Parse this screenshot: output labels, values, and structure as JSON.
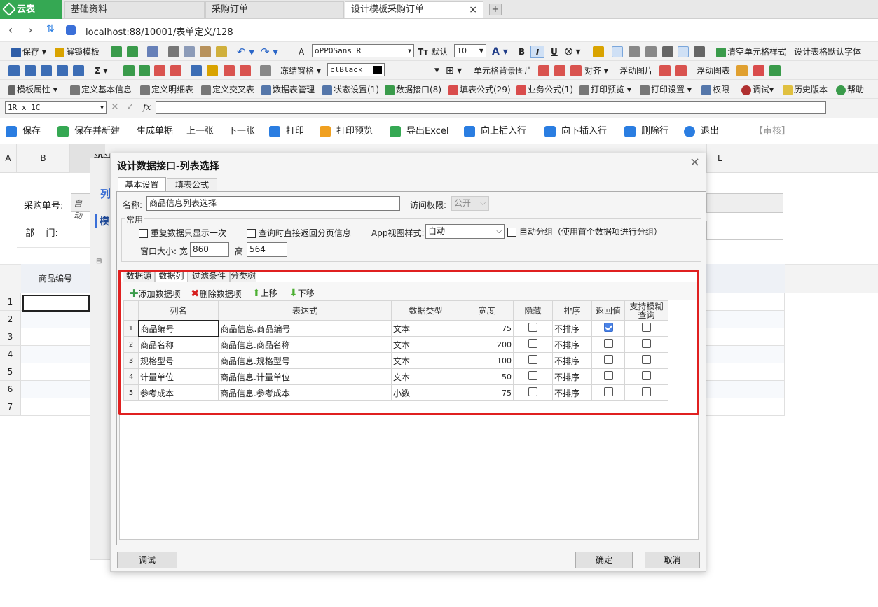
{
  "tabs": {
    "home": "云表",
    "t1": "基础资料",
    "t2": "采购订单",
    "t3": "设计模板采购订单",
    "close": "×",
    "add": "+"
  },
  "address": {
    "url": "localhost:88/10001/表单定义/128"
  },
  "toolbar1": {
    "save": "保存",
    "unlock": "解锁模板",
    "font_label": "A",
    "font_name": "oPPOSans R",
    "default_size": "默认",
    "size": "10",
    "bold": "B",
    "italic": "I",
    "underline": "U",
    "clear_style": "清空单元格样式",
    "default_font": "设计表格默认字体"
  },
  "toolbar2": {
    "sigma": "Σ",
    "freeze": "冻结窗格",
    "color": "clBlack",
    "bg_image": "单元格背景图片",
    "align": "对齐",
    "float_image": "浮动图片",
    "float_chart": "浮动图表"
  },
  "toolbar3": {
    "template_props": "模板属性",
    "basic_info": "定义基本信息",
    "detail_table": "定义明细表",
    "cross_table": "定义交叉表",
    "table_mgmt": "数据表管理",
    "status": "状态设置(1)",
    "interface": "数据接口(8)",
    "formula": "填表公式(29)",
    "business": "业务公式(1)",
    "print_preview": "打印预览",
    "print_settings": "打印设置",
    "permission": "权限",
    "debug": "调试",
    "history": "历史版本",
    "help": "帮助"
  },
  "formula_bar": {
    "cell_ref": "1R x 1C",
    "fx": "fx"
  },
  "actions": {
    "save": "保存",
    "save_new": "保存并新建",
    "gen": "生成单据",
    "prev": "上一张",
    "next": "下一张",
    "print": "打印",
    "preview": "打印预览",
    "excel": "导出Excel",
    "insert_up": "向上插入行",
    "insert_down": "向下插入行",
    "delete_row": "删除行",
    "exit": "退出",
    "audit": "【审核】"
  },
  "sheet": {
    "col_a": "A",
    "col_b": "B",
    "col_l": "L",
    "order_no_label": "采购单号:",
    "order_no_value": "自动",
    "dept_label": "部    门:",
    "item_header": "商品编号",
    "rows": [
      "1",
      "2",
      "3",
      "4",
      "5",
      "6",
      "7"
    ],
    "behind_title": "设计",
    "behind_col": "列",
    "behind_mod": "模"
  },
  "dialog": {
    "title": "设计数据接口-列表选择",
    "close": "×",
    "tab_basic": "基本设置",
    "tab_formula": "填表公式",
    "name_label": "名称:",
    "name_value": "商品信息列表选择",
    "access_label": "访问权限:",
    "access_value": "公开",
    "common": "常用",
    "cb_once": "重复数据只显示一次",
    "cb_page": "查询时直接返回分页信息",
    "app_style_label": "App视图样式:",
    "app_style_value": "自动",
    "cb_group": "自动分组（使用首个数据项进行分组）",
    "win_size_label": "窗口大小: 宽",
    "width": "860",
    "height_label": "高",
    "height": "564",
    "subtabs": [
      "数据源",
      "数据列",
      "过滤条件",
      "分类树"
    ],
    "add_item": "添加数据项",
    "del_item": "删除数据项",
    "move_up": "上移",
    "move_down": "下移",
    "debug": "调试",
    "ok": "确定",
    "cancel": "取消"
  },
  "grid": {
    "headers": [
      "列名",
      "表达式",
      "数据类型",
      "宽度",
      "隐藏",
      "排序",
      "返回值",
      "支持模糊查询"
    ],
    "rows": [
      {
        "n": "1",
        "name": "商品编号",
        "expr": "商品信息.商品编号",
        "type": "文本",
        "width": "75",
        "hidden": false,
        "sort": "不排序",
        "ret": true,
        "fuzzy": false
      },
      {
        "n": "2",
        "name": "商品名称",
        "expr": "商品信息.商品名称",
        "type": "文本",
        "width": "200",
        "hidden": false,
        "sort": "不排序",
        "ret": false,
        "fuzzy": false
      },
      {
        "n": "3",
        "name": "规格型号",
        "expr": "商品信息.规格型号",
        "type": "文本",
        "width": "100",
        "hidden": false,
        "sort": "不排序",
        "ret": false,
        "fuzzy": false
      },
      {
        "n": "4",
        "name": "计量单位",
        "expr": "商品信息.计量单位",
        "type": "文本",
        "width": "50",
        "hidden": false,
        "sort": "不排序",
        "ret": false,
        "fuzzy": false
      },
      {
        "n": "5",
        "name": "参考成本",
        "expr": "商品信息.参考成本",
        "type": "小数",
        "width": "75",
        "hidden": false,
        "sort": "不排序",
        "ret": false,
        "fuzzy": false
      }
    ]
  },
  "colors": {
    "accent": "#35a853",
    "highlight": "#e02020",
    "checked": "#4a82e6"
  }
}
